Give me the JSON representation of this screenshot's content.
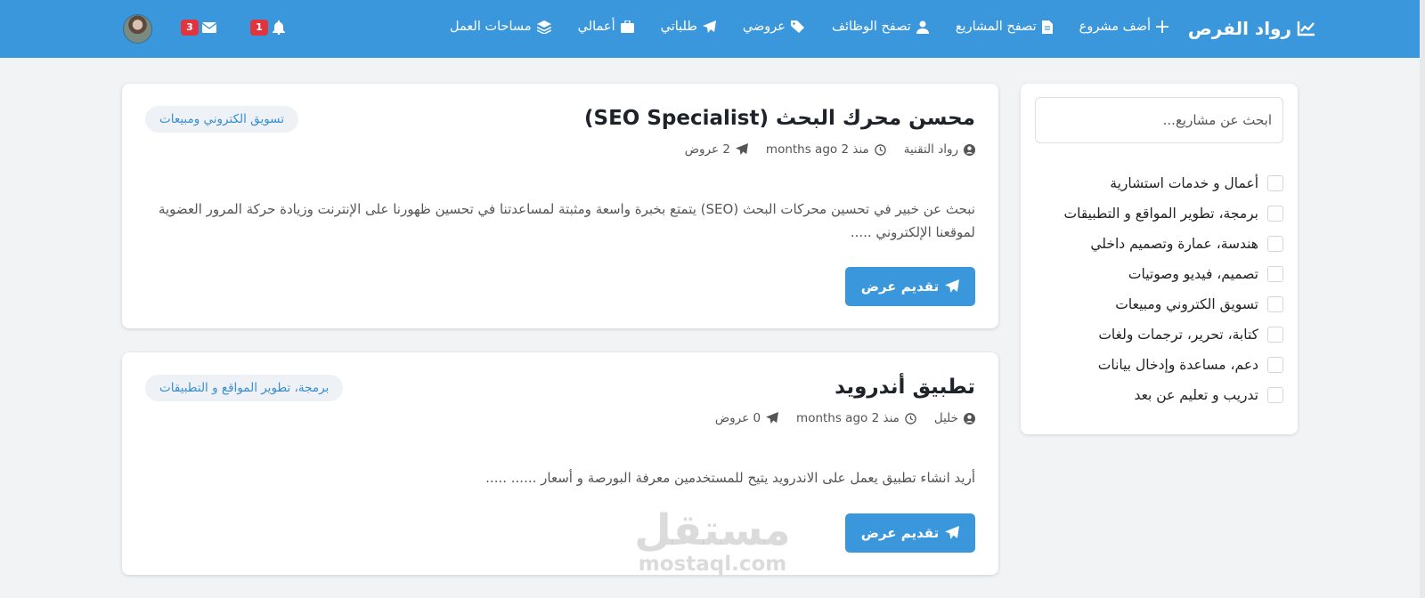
{
  "navbar": {
    "brand": "رواد الفرص",
    "items": [
      {
        "label": "أضف مشروع",
        "icon": "plus-icon"
      },
      {
        "label": "تصفح المشاريع",
        "icon": "file-icon"
      },
      {
        "label": "تصفح الوظائف",
        "icon": "user-tie-icon"
      },
      {
        "label": "عروضي",
        "icon": "tags-icon"
      },
      {
        "label": "طلباتي",
        "icon": "paper-plane-icon"
      },
      {
        "label": "أعمالي",
        "icon": "briefcase-icon"
      },
      {
        "label": "مساحات العمل",
        "icon": "layers-icon"
      }
    ],
    "notifications_count": "1",
    "messages_count": "3"
  },
  "sidebar": {
    "search_placeholder": "ابحث عن مشاريع...",
    "categories": [
      "أعمال و خدمات استشارية",
      "برمجة، تطوير المواقع و التطبيقات",
      "هندسة، عمارة وتصميم داخلي",
      "تصميم، فيديو وصوتيات",
      "تسويق الكتروني ومبيعات",
      "كتابة، تحرير، ترجمات ولغات",
      "دعم، مساعدة وإدخال بيانات",
      "تدريب و تعليم عن بعد"
    ]
  },
  "projects": [
    {
      "title": "محسن محرك البحث (SEO Specialist)",
      "owner": "رواد التقنية",
      "time": "منذ 2 months ago",
      "offers": "2 عروض",
      "category": "تسويق الكتروني ومبيعات",
      "description": "نبحث عن خبير في تحسين محركات البحث (SEO) يتمتع بخبرة واسعة ومثبتة لمساعدتنا في تحسين ظهورنا على الإنترنت وزيادة حركة المرور العضوية لموقعنا الإلكتروني .....",
      "button": "تقديم عرض"
    },
    {
      "title": "تطبيق أندرويد",
      "owner": "خليل",
      "time": "منذ 2 months ago",
      "offers": "0 عروض",
      "category": "برمجة، تطوير المواقع و التطبيقات",
      "description": "أريد انشاء تطبيق يعمل على الاندرويد يتيح للمستخدمين معرفة البورصة و أسعار ...... .....",
      "button": "تقديم عرض"
    }
  ],
  "watermark": {
    "arabic": "مستقل",
    "latin": "mostaql.com"
  },
  "colors": {
    "primary": "#3a97dc",
    "badge": "#e0343f",
    "background": "#f2f3f5"
  }
}
